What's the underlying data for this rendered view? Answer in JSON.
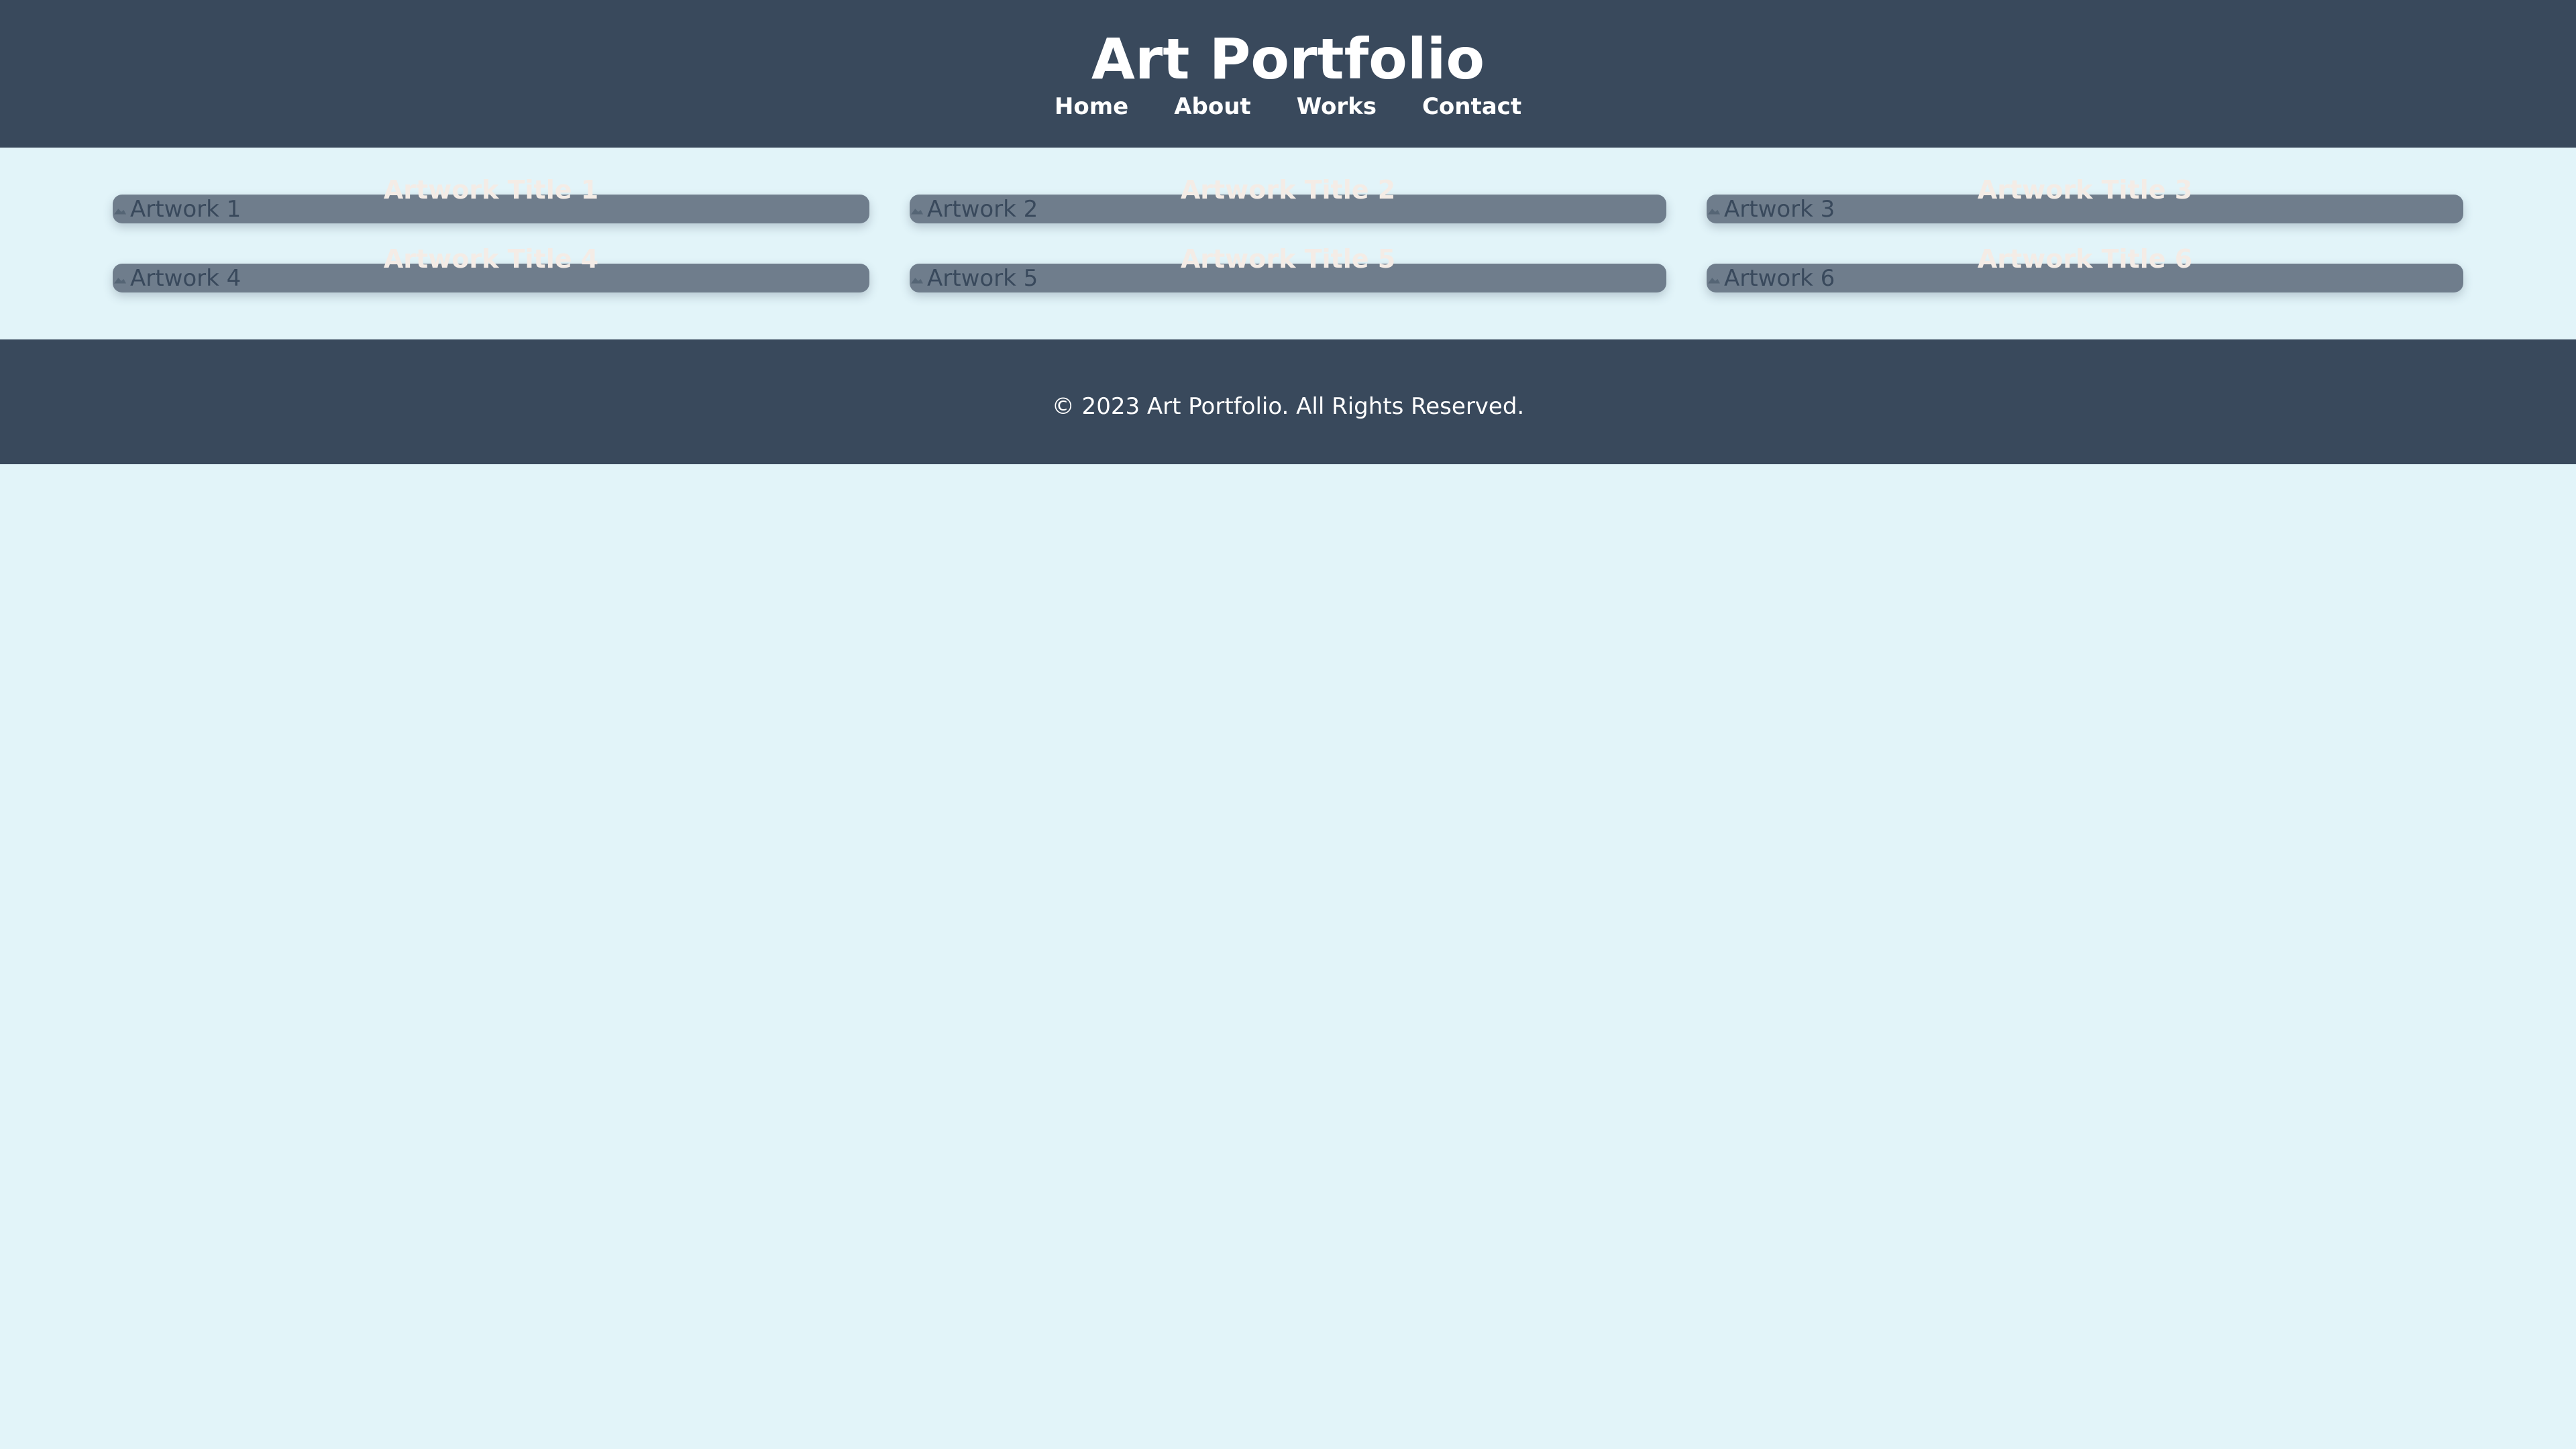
{
  "header": {
    "title": "Art Portfolio",
    "nav": [
      {
        "label": "Home"
      },
      {
        "label": "About"
      },
      {
        "label": "Works"
      },
      {
        "label": "Contact"
      }
    ]
  },
  "gallery": {
    "items": [
      {
        "alt": "Artwork 1",
        "title": "Artwork Title 1"
      },
      {
        "alt": "Artwork 2",
        "title": "Artwork Title 2"
      },
      {
        "alt": "Artwork 3",
        "title": "Artwork Title 3"
      },
      {
        "alt": "Artwork 4",
        "title": "Artwork Title 4"
      },
      {
        "alt": "Artwork 5",
        "title": "Artwork Title 5"
      },
      {
        "alt": "Artwork 6",
        "title": "Artwork Title 6"
      }
    ]
  },
  "footer": {
    "text": "© 2023 Art Portfolio. All Rights Reserved."
  },
  "colors": {
    "header_bg": "#39495c",
    "page_bg": "#e2f4f9",
    "card_bg": "#6f7d8c",
    "title_text": "#f4ece6"
  }
}
